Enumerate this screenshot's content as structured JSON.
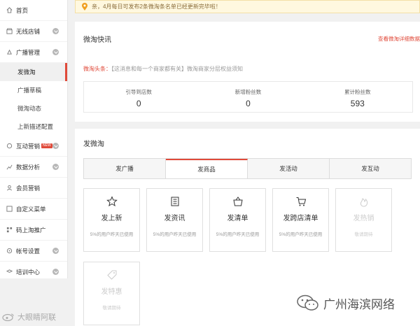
{
  "sidebar": {
    "items": [
      {
        "label": "首页",
        "icon": "home-icon"
      },
      {
        "label": "无线店铺",
        "icon": "store-icon"
      },
      {
        "label": "广播管理",
        "icon": "broadcast-icon"
      },
      {
        "label": "互动营销",
        "icon": "interact-icon",
        "badge": "NEW"
      },
      {
        "label": "数据分析",
        "icon": "data-icon"
      },
      {
        "label": "会员营销",
        "icon": "member-icon"
      },
      {
        "label": "自定义菜单",
        "icon": "menu-icon"
      },
      {
        "label": "码上淘推广",
        "icon": "qrcode-icon"
      },
      {
        "label": "帐号设置",
        "icon": "account-icon"
      },
      {
        "label": "培训中心",
        "icon": "training-icon"
      }
    ],
    "subitems": [
      "发微淘",
      "广播草稿",
      "微淘动态",
      "上新描述配置"
    ]
  },
  "notice": {
    "text": "亲，4月每日可发布2条微淘条名单已经更新完毕啦！"
  },
  "quick": {
    "title": "微淘快讯",
    "link": "查看微淘详细数据",
    "headline_label": "微淘头条：",
    "headline_text": "【这消息和每一个商家都有关】微淘商家分层权益须知",
    "stats": [
      {
        "label": "引导到店数",
        "value": "0"
      },
      {
        "label": "新增粉丝数",
        "value": "0"
      },
      {
        "label": "累计粉丝数",
        "value": "593"
      }
    ]
  },
  "post": {
    "title": "发微淘",
    "tabs": [
      "发广播",
      "发商品",
      "发活动",
      "发互动"
    ],
    "active_tab": "发商品",
    "cards": [
      {
        "title": "发上新",
        "sub": "5%的用户昨天已使用",
        "icon": "star-icon"
      },
      {
        "title": "发资讯",
        "sub": "5%的用户昨天已使用",
        "icon": "news-icon"
      },
      {
        "title": "发清单",
        "sub": "5%的用户昨天已使用",
        "icon": "basket-icon"
      },
      {
        "title": "发跨店清单",
        "sub": "5%的用户昨天已使用",
        "icon": "cart-icon"
      },
      {
        "title": "发热销",
        "sub": "敬请期待",
        "icon": "fire-icon"
      },
      {
        "title": "发特惠",
        "sub": "敬请期待",
        "icon": "tag-icon"
      }
    ]
  },
  "watermark": {
    "left": "大眼睛阿联",
    "right": "广州海滨网络"
  },
  "colors": {
    "accent": "#e04a3a",
    "notice_bg": "#fff8df"
  }
}
